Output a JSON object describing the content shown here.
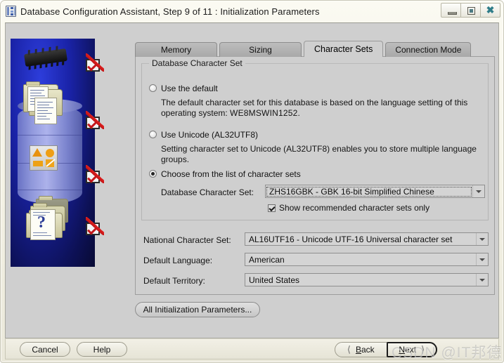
{
  "window": {
    "title": "Database Configuration Assistant, Step 9 of 11 : Initialization Parameters",
    "app_icon": "database-app-icon",
    "controls": {
      "minimize": "minimize-icon",
      "maximize": "maximize-icon",
      "close": "close-icon"
    }
  },
  "tabs": [
    {
      "label": "Memory",
      "active": false
    },
    {
      "label": "Sizing",
      "active": false
    },
    {
      "label": "Character Sets",
      "active": true
    },
    {
      "label": "Connection Mode",
      "active": false
    }
  ],
  "group": {
    "title": "Database Character Set",
    "options": [
      {
        "label": "Use the default",
        "selected": false,
        "description_line1": "The default character set for this database is based on the language setting of this",
        "description_line2_prefix": "operating system: ",
        "description_line2_value": "WE8MSWIN1252."
      },
      {
        "label": "Use Unicode (AL32UTF8)",
        "selected": false,
        "description_line1": "Setting character set to Unicode (AL32UTF8) enables you to store multiple language",
        "description_line2_prefix": "groups.",
        "description_line2_value": ""
      },
      {
        "label": "Choose from the list of character sets",
        "selected": true
      }
    ],
    "database_character_set": {
      "label": "Database Character Set:",
      "value": "ZHS16GBK - GBK 16-bit Simplified Chinese",
      "focused": true
    },
    "show_recommended": {
      "label": "Show recommended character sets only",
      "checked": true
    }
  },
  "fields": [
    {
      "label": "National Character Set:",
      "value": "AL16UTF16 - Unicode UTF-16 Universal character set"
    },
    {
      "label": "Default Language:",
      "value": "American"
    },
    {
      "label": "Default Territory:",
      "value": "United States"
    }
  ],
  "all_params_button": {
    "label": "All Initialization Parameters..."
  },
  "bottom_bar": {
    "cancel": "Cancel",
    "help": "Help",
    "back": "Back",
    "back_mnemonic": "B",
    "next": "Next",
    "next_mnemonic": "N",
    "back_chevron": "chevron-left-icon",
    "next_chevron": "chevron-right-icon"
  },
  "watermark": "CSDN @IT邦德",
  "colors": {
    "window_frame": "#f3f1e4",
    "client_bg": "#cfcfcf",
    "panel_blue": "#1a23a8",
    "check_red": "#c4171b",
    "close_icon": "#2f7d89"
  },
  "graphic": {
    "name": "database-configuration-illustration",
    "checkmarks": 4,
    "icons": [
      "memory-chip-icon",
      "documents-folder-icon",
      "shapes-tile-icon",
      "question-document-icon",
      "database-cylinder-icon"
    ]
  }
}
